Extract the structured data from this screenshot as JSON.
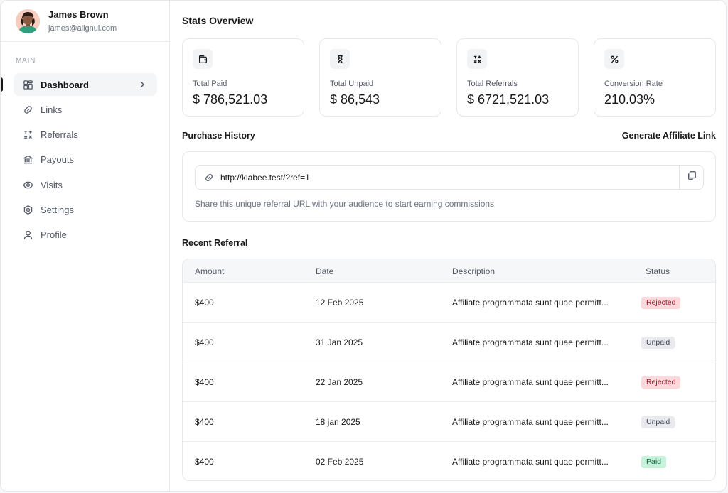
{
  "user": {
    "name": "James Brown",
    "email": "james@alignui.com"
  },
  "sidebar": {
    "section": "MAIN",
    "items": [
      {
        "label": "Dashboard",
        "icon": "dashboard-icon",
        "active": true
      },
      {
        "label": "Links",
        "icon": "link-icon"
      },
      {
        "label": "Referrals",
        "icon": "referrals-icon"
      },
      {
        "label": "Payouts",
        "icon": "bank-icon"
      },
      {
        "label": "Visits",
        "icon": "eye-icon"
      },
      {
        "label": "Settings",
        "icon": "gear-icon"
      },
      {
        "label": "Profile",
        "icon": "user-icon"
      }
    ]
  },
  "stats": {
    "title": "Stats Overview",
    "cards": [
      {
        "label": "Total Paid",
        "value": "$ 786,521.03",
        "icon": "wallet-icon"
      },
      {
        "label": "Total Unpaid",
        "value": "$ 86,543",
        "icon": "hourglass-icon"
      },
      {
        "label": "Total Referrals",
        "value": "$ 6721,521.03",
        "icon": "referrals-icon"
      },
      {
        "label": "Conversion Rate",
        "value": "210.03%",
        "icon": "percent-icon"
      }
    ]
  },
  "purchase": {
    "title": "Purchase History",
    "generate_label": "Generate Affiliate Link",
    "url": "http://klabee.test/?ref=1",
    "help": "Share this unique referral URL with your audience to start earning commissions"
  },
  "recent": {
    "title": "Recent Referral",
    "columns": [
      "Amount",
      "Date",
      "Description",
      "Status"
    ],
    "rows": [
      {
        "amount": "$400",
        "date": "12 Feb 2025",
        "description": "Affiliate programmata sunt quae permitt...",
        "status": "Rejected"
      },
      {
        "amount": "$400",
        "date": "31 Jan 2025",
        "description": "Affiliate programmata sunt quae permitt...",
        "status": "Unpaid"
      },
      {
        "amount": "$400",
        "date": "22 Jan 2025",
        "description": "Affiliate programmata sunt quae permitt...",
        "status": "Rejected"
      },
      {
        "amount": "$400",
        "date": "18 jan 2025",
        "description": "Affiliate programmata sunt quae permitt...",
        "status": "Unpaid"
      },
      {
        "amount": "$400",
        "date": "02 Feb 2025",
        "description": "Affiliate programmata sunt quae permitt...",
        "status": "Paid"
      }
    ]
  },
  "status_colors": {
    "Rejected": {
      "bg": "#fcd7dc",
      "fg": "#9f1d2d"
    },
    "Unpaid": {
      "bg": "#e8eaee",
      "fg": "#3f4652"
    },
    "Paid": {
      "bg": "#c8f1dc",
      "fg": "#156a3f"
    }
  }
}
